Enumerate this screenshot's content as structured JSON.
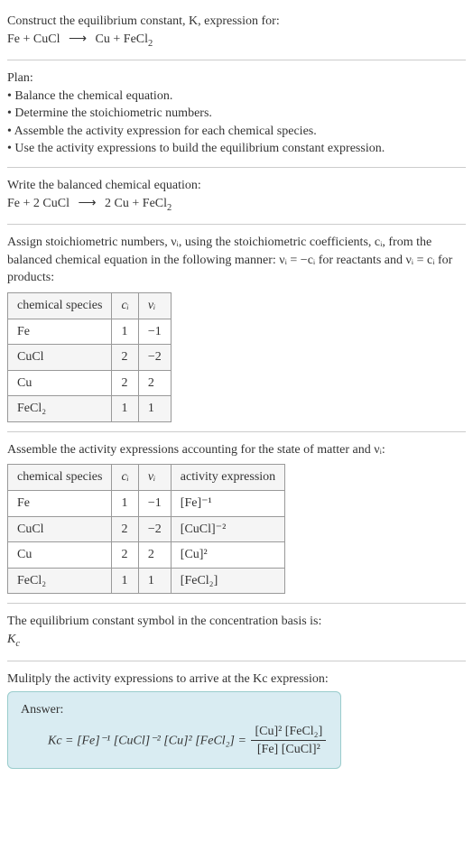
{
  "intro": {
    "line1": "Construct the equilibrium constant, K, expression for:",
    "equation_left": "Fe + CuCl",
    "arrow": "⟶",
    "equation_right": "Cu + FeCl",
    "equation_right_sub": "2"
  },
  "plan": {
    "heading": "Plan:",
    "b1": "• Balance the chemical equation.",
    "b2": "• Determine the stoichiometric numbers.",
    "b3": "• Assemble the activity expression for each chemical species.",
    "b4": "• Use the activity expressions to build the equilibrium constant expression."
  },
  "balanced": {
    "heading": "Write the balanced chemical equation:",
    "left": "Fe + 2 CuCl",
    "arrow": "⟶",
    "right1": "2 Cu + FeCl",
    "right1_sub": "2"
  },
  "assign": {
    "text": "Assign stoichiometric numbers, νᵢ, using the stoichiometric coefficients, cᵢ, from the balanced chemical equation in the following manner: νᵢ = −cᵢ for reactants and νᵢ = cᵢ for products:"
  },
  "table1": {
    "h1": "chemical species",
    "h2": "cᵢ",
    "h3": "νᵢ",
    "rows": [
      {
        "sp": "Fe",
        "c": "1",
        "v": "−1"
      },
      {
        "sp": "CuCl",
        "c": "2",
        "v": "−2"
      },
      {
        "sp": "Cu",
        "c": "2",
        "v": "2"
      },
      {
        "sp": "FeCl₂",
        "c": "1",
        "v": "1"
      }
    ]
  },
  "assemble": {
    "text": "Assemble the activity expressions accounting for the state of matter and νᵢ:"
  },
  "table2": {
    "h1": "chemical species",
    "h2": "cᵢ",
    "h3": "νᵢ",
    "h4": "activity expression",
    "rows": [
      {
        "sp": "Fe",
        "c": "1",
        "v": "−1",
        "a": "[Fe]⁻¹"
      },
      {
        "sp": "CuCl",
        "c": "2",
        "v": "−2",
        "a": "[CuCl]⁻²"
      },
      {
        "sp": "Cu",
        "c": "2",
        "v": "2",
        "a": "[Cu]²"
      },
      {
        "sp": "FeCl₂",
        "c": "1",
        "v": "1",
        "a": "[FeCl₂]"
      }
    ]
  },
  "symbol": {
    "text": "The equilibrium constant symbol in the concentration basis is:",
    "kc": "K",
    "kc_sub": "c"
  },
  "multiply": {
    "text": "Mulitply the activity expressions to arrive at the Kc expression:"
  },
  "answer": {
    "label": "Answer:",
    "lhs": "Kc = [Fe]⁻¹ [CuCl]⁻² [Cu]² [FeCl₂] =",
    "num": "[Cu]² [FeCl₂]",
    "den": "[Fe] [CuCl]²"
  },
  "chart_data": null
}
